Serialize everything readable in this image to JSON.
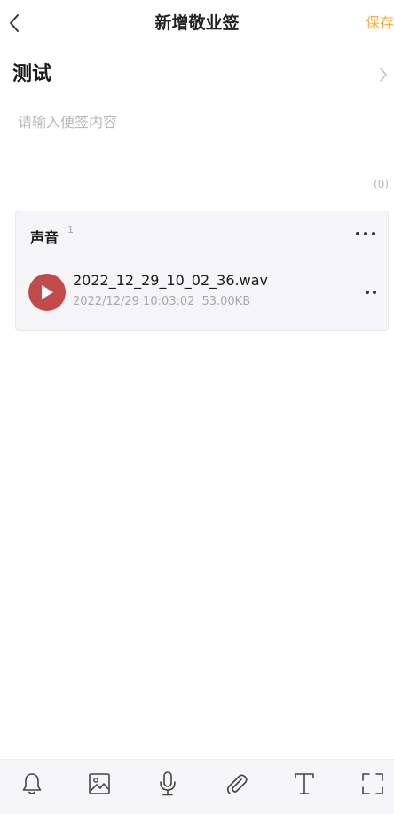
{
  "header": {
    "back_icon": "chevron-left-icon",
    "title": "新增敬业签",
    "save_label": "保存",
    "save_color": "#f2b04a"
  },
  "note": {
    "title": "测试",
    "title_chevron_icon": "chevron-right-icon",
    "content_value": "",
    "content_placeholder": "请输入便签内容",
    "char_count": "(0)"
  },
  "sound_card": {
    "label": "声音",
    "count": "1",
    "more_icon": "more-horizontal-icon",
    "items": [
      {
        "play_icon": "play-icon",
        "play_color": "#c24a4a",
        "file_name": "2022_12_29_10_02_36.wav",
        "timestamp": "2022/12/29 10:03:02",
        "size": "53.00KB",
        "more_icon": "more-dots-icon"
      }
    ]
  },
  "toolbar": {
    "items": [
      {
        "icon": "bell-icon"
      },
      {
        "icon": "image-icon"
      },
      {
        "icon": "microphone-icon"
      },
      {
        "icon": "paperclip-icon"
      },
      {
        "icon": "text-format-icon"
      },
      {
        "icon": "fullscreen-icon"
      }
    ]
  }
}
